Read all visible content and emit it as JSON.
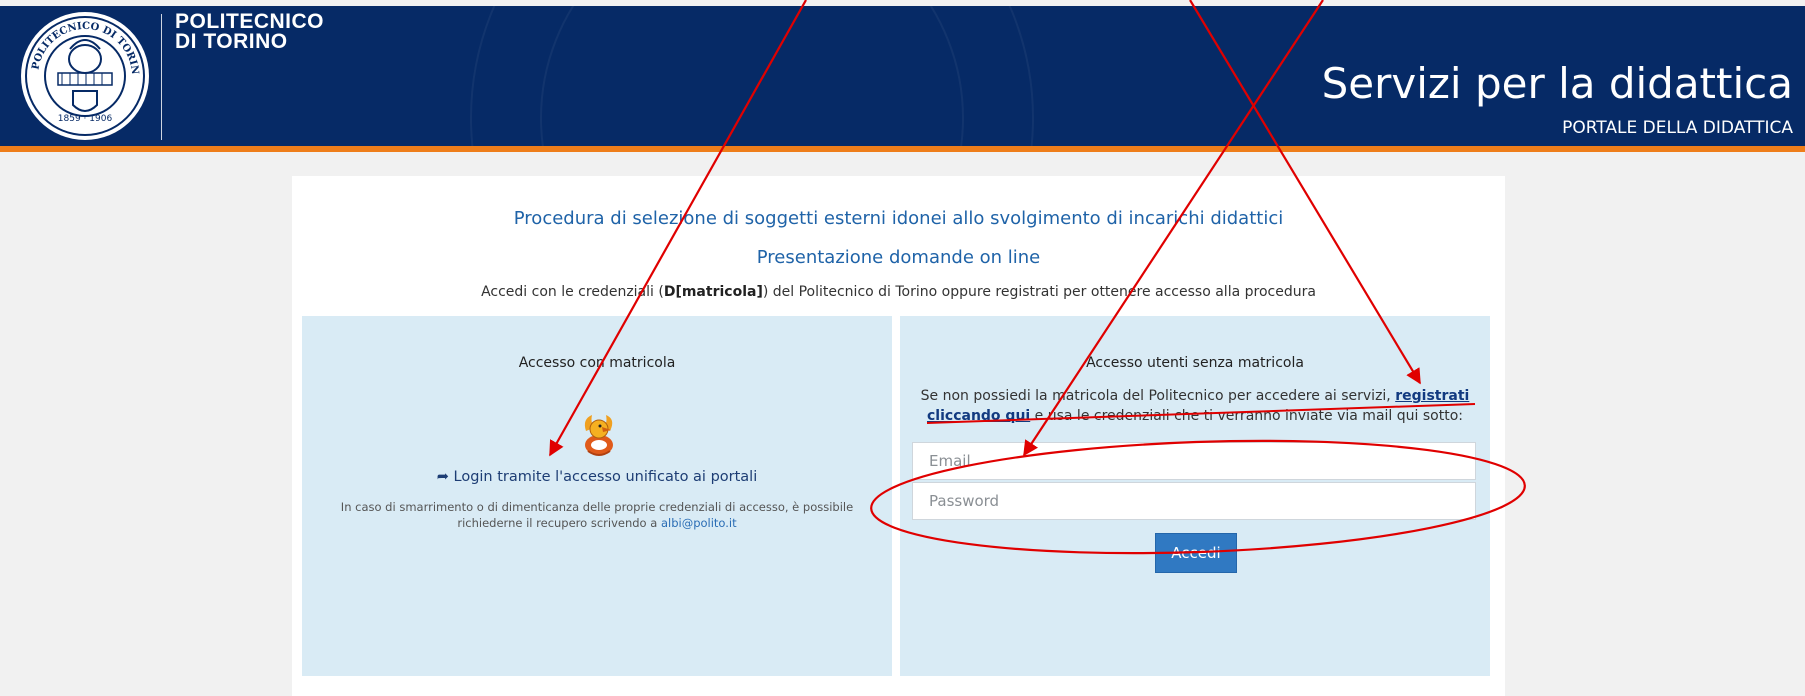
{
  "header": {
    "university_line1": "POLITECNICO",
    "university_line2": "DI TORINO",
    "site_title": "Servizi per la didattica",
    "site_subtitle": "PORTALE DELLA DIDATTICA",
    "seal_text_top": "POLITECNICO DI TORINO",
    "seal_years": "1859 · 1906",
    "colors": {
      "bar": "#062a66",
      "strip": "#ee7d1a"
    }
  },
  "intro": {
    "title": "Procedura di selezione di soggetti esterni idonei allo svolgimento di incarichi didattici",
    "subtitle": "Presentazione domande on line",
    "text_before": "Accedi con le credenziali (",
    "text_bold": "D[matricola]",
    "text_after": ") del Politecnico di Torino oppure registrati per ottenere accesso alla procedura"
  },
  "left_panel": {
    "title": "Accesso con matricola",
    "login_icon": "share-arrow-icon",
    "login_link": "Login tramite l'accesso unificato ai portali",
    "note_text": "In caso di smarrimento o di dimenticanza delle proprie credenziali di accesso, è possibile richiederne il recupero scrivendo a",
    "note_email": "albi@polito.it"
  },
  "right_panel": {
    "title": "Accesso utenti senza matricola",
    "text_before": "Se non possiedi la matricola del Politecnico per accedere ai servizi,",
    "register_link": "registrati cliccando qui",
    "text_after": "e usa le credenziali che ti verranno inviate via mail qui sotto:",
    "email_placeholder": "Email",
    "password_placeholder": "Password",
    "submit_label": "Accedi"
  },
  "annotations": {
    "color": "#e00000"
  }
}
